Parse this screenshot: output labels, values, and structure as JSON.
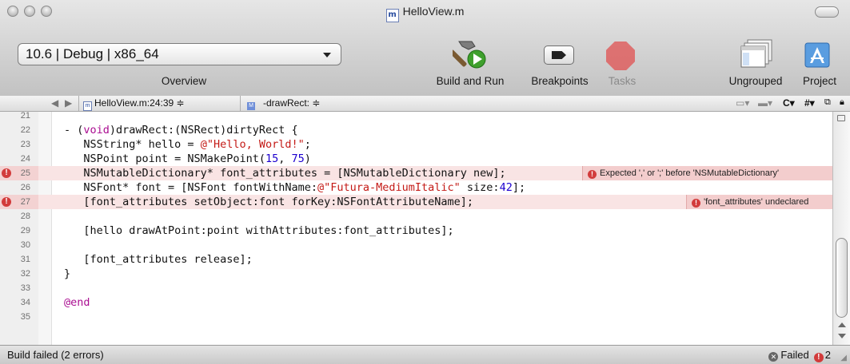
{
  "window": {
    "title": "HelloView.m",
    "file_icon_letter": "m"
  },
  "toolbar": {
    "scheme_value": "10.6 | Debug | x86_64",
    "overview_label": "Overview",
    "build_and_run_label": "Build and Run",
    "breakpoints_label": "Breakpoints",
    "tasks_label": "Tasks",
    "ungrouped_label": "Ungrouped",
    "project_label": "Project"
  },
  "navigator": {
    "back": "◀",
    "forward": "▶",
    "file_location": "HelloView.m:24:39 ≑",
    "method": "-drawRect: ≑",
    "right_controls": [
      "C▾",
      "#▾"
    ]
  },
  "editor": {
    "lines": [
      {
        "num": "21",
        "code": ""
      },
      {
        "num": "22",
        "code": "- (void)drawRect:(NSRect)dirtyRect {"
      },
      {
        "num": "23",
        "code": "   NSString* hello = @\"Hello, World!\";"
      },
      {
        "num": "24",
        "code": "   NSPoint point = NSMakePoint(15, 75)"
      },
      {
        "num": "25",
        "code": "   NSMutableDictionary* font_attributes = [NSMutableDictionary new];",
        "error": true
      },
      {
        "num": "26",
        "code": "   NSFont* font = [NSFont fontWithName:@\"Futura-MediumItalic\" size:42];"
      },
      {
        "num": "27",
        "code": "   [font_attributes setObject:font forKey:NSFontAttributeName];",
        "error": true
      },
      {
        "num": "28",
        "code": ""
      },
      {
        "num": "29",
        "code": "   [hello drawAtPoint:point withAttributes:font_attributes];"
      },
      {
        "num": "30",
        "code": ""
      },
      {
        "num": "31",
        "code": "   [font_attributes release];"
      },
      {
        "num": "32",
        "code": "}"
      },
      {
        "num": "33",
        "code": ""
      },
      {
        "num": "34",
        "code": "@end"
      },
      {
        "num": "35",
        "code": ""
      }
    ],
    "errors": [
      {
        "line": "25",
        "message": "Expected ',' or ';' before 'NSMutableDictionary'"
      },
      {
        "line": "27",
        "message": "'font_attributes' undeclared"
      }
    ]
  },
  "status": {
    "message": "Build failed (2 errors)",
    "result": "Failed",
    "error_count": "2"
  },
  "colors": {
    "error_red": "#d23b3b",
    "error_line_bg": "#f9e4e4",
    "keyword": "#aa0d91",
    "string": "#c41a16",
    "number": "#1c00cf"
  }
}
